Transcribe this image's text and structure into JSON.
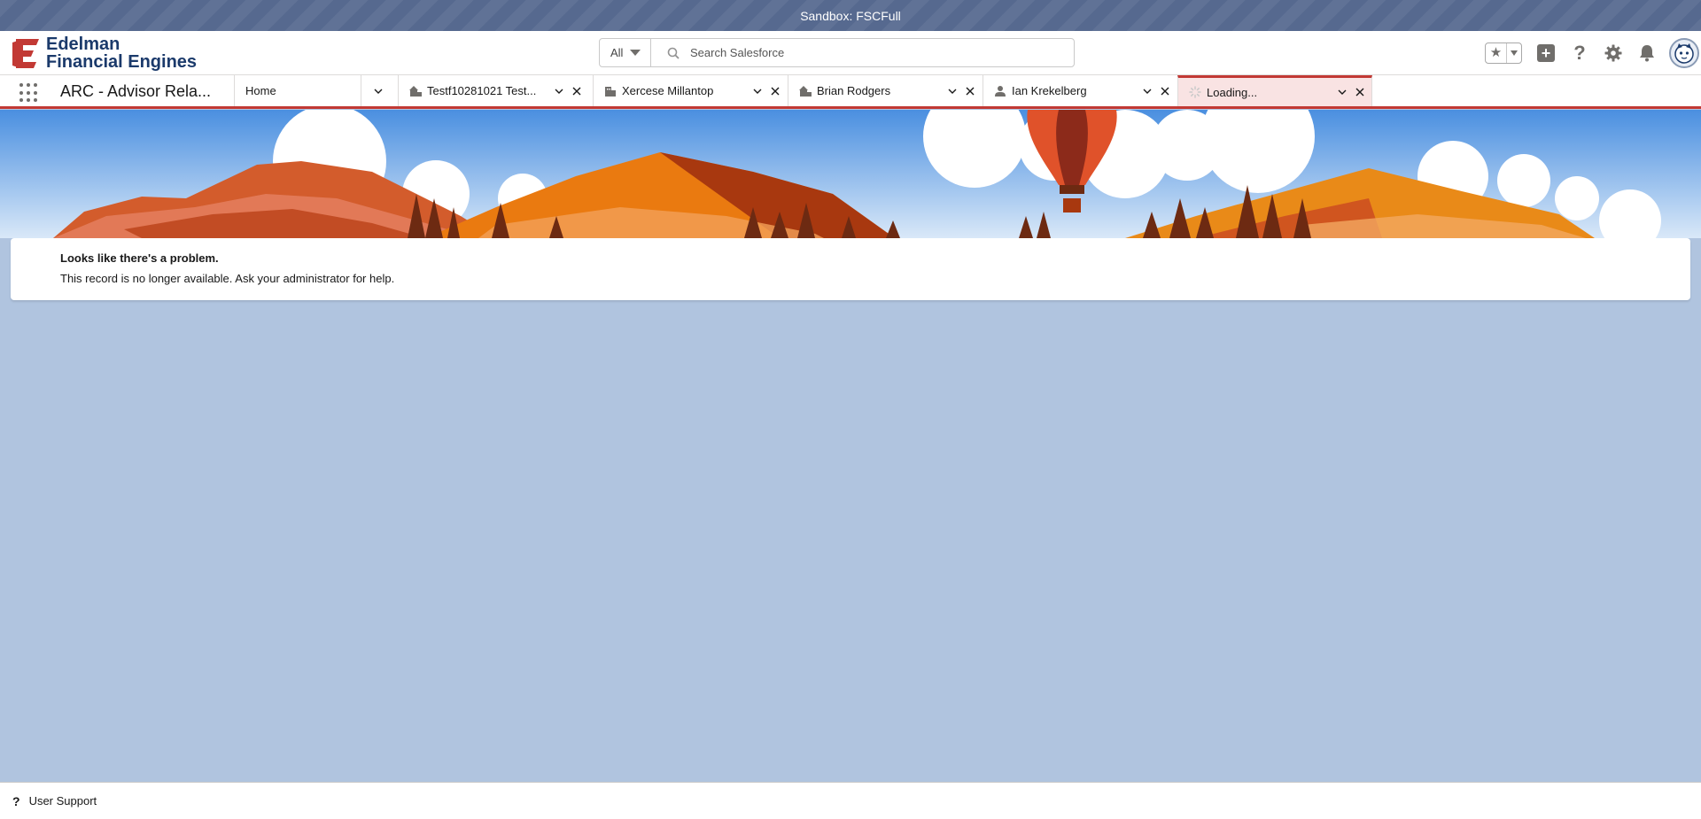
{
  "sandbox": {
    "label": "Sandbox: FSCFull"
  },
  "logo": {
    "line1": "Edelman",
    "line2": "Financial Engines",
    "brand_color": "#c23934"
  },
  "search": {
    "scope": "All",
    "placeholder": "Search Salesforce"
  },
  "header_icons": [
    "star-icon",
    "chevron-down-icon",
    "plus-icon",
    "help-icon",
    "gear-icon",
    "bell-icon",
    "avatar"
  ],
  "nav": {
    "app_name": "ARC - Advisor Rela...",
    "tabs": [
      {
        "label": "Home",
        "icon": "none"
      },
      {
        "label": "Testf10281021 Test...",
        "icon": "household-icon"
      },
      {
        "label": "Xercese Millantop",
        "icon": "building-icon"
      },
      {
        "label": "Brian Rodgers",
        "icon": "household-icon"
      },
      {
        "label": "Ian Krekelberg",
        "icon": "person-icon"
      },
      {
        "label": "Loading...",
        "icon": "spinner-icon",
        "active": true
      }
    ]
  },
  "error": {
    "title": "Looks like there's a problem.",
    "message": "This record is no longer available. Ask your administrator for help."
  },
  "footer": {
    "label": "User Support"
  },
  "colors": {
    "sandbox_bar": "#56698f",
    "accent_red": "#c23934",
    "page_bg": "#b0c4df"
  }
}
